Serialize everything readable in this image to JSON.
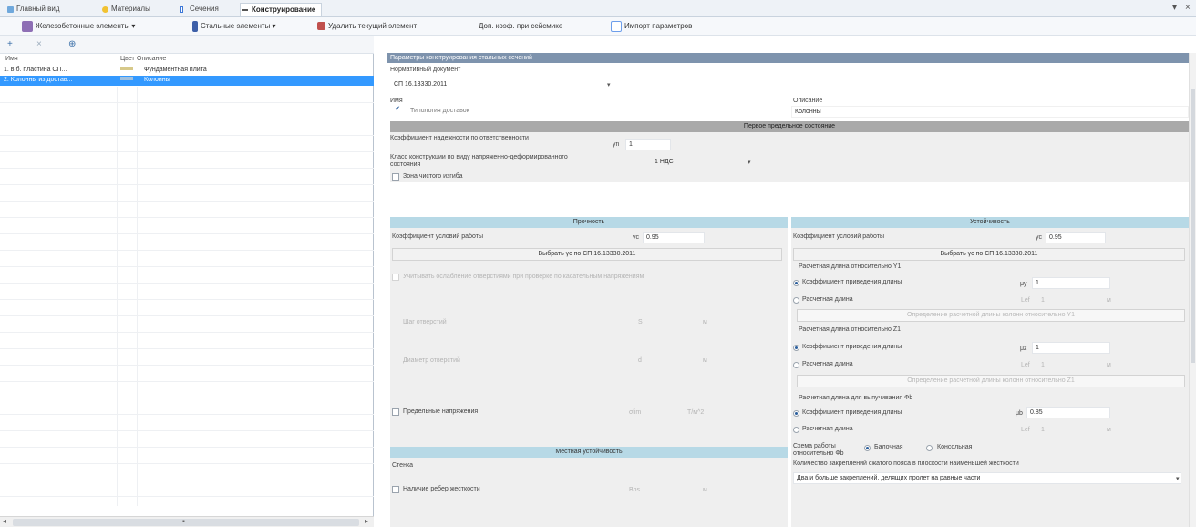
{
  "tabs": [
    {
      "label": "Главный вид",
      "icon": "home-icon",
      "active": false
    },
    {
      "label": "Материалы",
      "icon": "materials-icon",
      "active": false
    },
    {
      "label": "Сечения",
      "icon": "section-icon",
      "active": false
    },
    {
      "label": "Конструирование",
      "icon": "design-icon",
      "active": true
    }
  ],
  "window_controls": {
    "pin": "▾",
    "close": "×"
  },
  "toolbar": {
    "rc_elements": "Железобетонные элементы",
    "steel_elements": "Стальные элементы",
    "delete_current": "Удалить текущий элемент",
    "extra_coef": "Доп. коэф. при сейсмике",
    "import_params": "Импорт параметров"
  },
  "left_panel": {
    "tools": [
      "+",
      "×",
      "⊕"
    ],
    "headers": {
      "name": "Имя",
      "color": "Цвет",
      "description": "Описание"
    },
    "rows": [
      {
        "name": "1. в.б. пластина СП...",
        "color": "#d7c98a",
        "description": "Фундаментная плита",
        "selected": false
      },
      {
        "name": "2. Колонны из достав...",
        "color": "#9fc0df",
        "description": "Колонны",
        "selected": true
      }
    ],
    "scroll_arrows": {
      "left": "◂",
      "middle": "▪",
      "right": "▸"
    }
  },
  "right_panel": {
    "header": "Параметры конструирования стальных сечений",
    "norm_doc_label": "Нормативный документ",
    "norm_doc_value": "СП 16.13330.2011",
    "name_label": "Имя",
    "description_label": "Описание",
    "name_value": "Типология доставок",
    "description_value": "Колонны",
    "first_limit_state": "Первое предельное состояние",
    "reliability_coef_label": "Коэффициент надежности по ответственности",
    "reliability_symbol": "γn",
    "reliability_value": "1",
    "construction_class_label": "Класс конструкции по виду напряженно-деформированного состояния",
    "construction_class_value": "1 НДС",
    "pure_bending_label": "Зона чистого изгиба",
    "strength": {
      "title": "Прочность",
      "work_coef_label": "Коэффициент условий работы",
      "work_coef_symbol": "γc",
      "work_coef_value": "0.95",
      "pick_button": "Выбрать γc по СП 16.13330.2011",
      "holes_label": "Учитывать ослабление отверстиями при проверке по касательным напряжениям",
      "hole_step_label": "Шаг отверстий",
      "hole_step_symbol": "S",
      "hole_diameter_label": "Диаметр отверстий",
      "hole_diameter_symbol": "d",
      "max_stress_label": "Предельные напряжения",
      "max_stress_symbol": "σlim",
      "max_stress_unit": "Т/м^2"
    },
    "local_stability": {
      "title": "Местная устойчивость",
      "wall_label": "Стенка",
      "ribs_label": "Наличие ребер жесткости",
      "ribs_symbol": "Bhs"
    },
    "stability": {
      "title": "Устойчивость",
      "work_coef_label": "Коэффициент условий работы",
      "work_coef_symbol": "γc",
      "work_coef_value": "0.95",
      "pick_button": "Выбрать γc по СП 16.13330.2011",
      "y1_title": "Расчетная длина относительно Y1",
      "z1_title": "Расчетная длина относительно Z1",
      "warp_title": "Расчетная длина для выпучивания Фb",
      "mu_label": "Коэффициент приведения длины",
      "length_label": "Расчетная длина",
      "mu_y": "1",
      "mu_z": "1",
      "mu_b": "0.85",
      "mu_symbol": "μy",
      "mu_z_symbol": "μz",
      "mu_b_symbol": "μb",
      "lef_symbol": "Lef",
      "lef_value": "1",
      "defined_y1_button": "Определение расчетной длины колонн относительно Y1",
      "defined_z1_button": "Определение расчетной длины колонн относительно Z1",
      "scheme_label": "Схема работы относительно Фb",
      "beam_option": "Балочная",
      "cantilever_option": "Консольная",
      "bracing_label": "Количество закреплений сжатого пояса в плоскости наименьшей жесткости",
      "bracing_value": "Два и больше закреплений, делящих пролет на равные части"
    }
  },
  "colors": {
    "panel_header": "#7e93ad",
    "section_grey": "#a9a9a9",
    "section_blue": "#b7d9e6",
    "selection": "#3399ff"
  }
}
